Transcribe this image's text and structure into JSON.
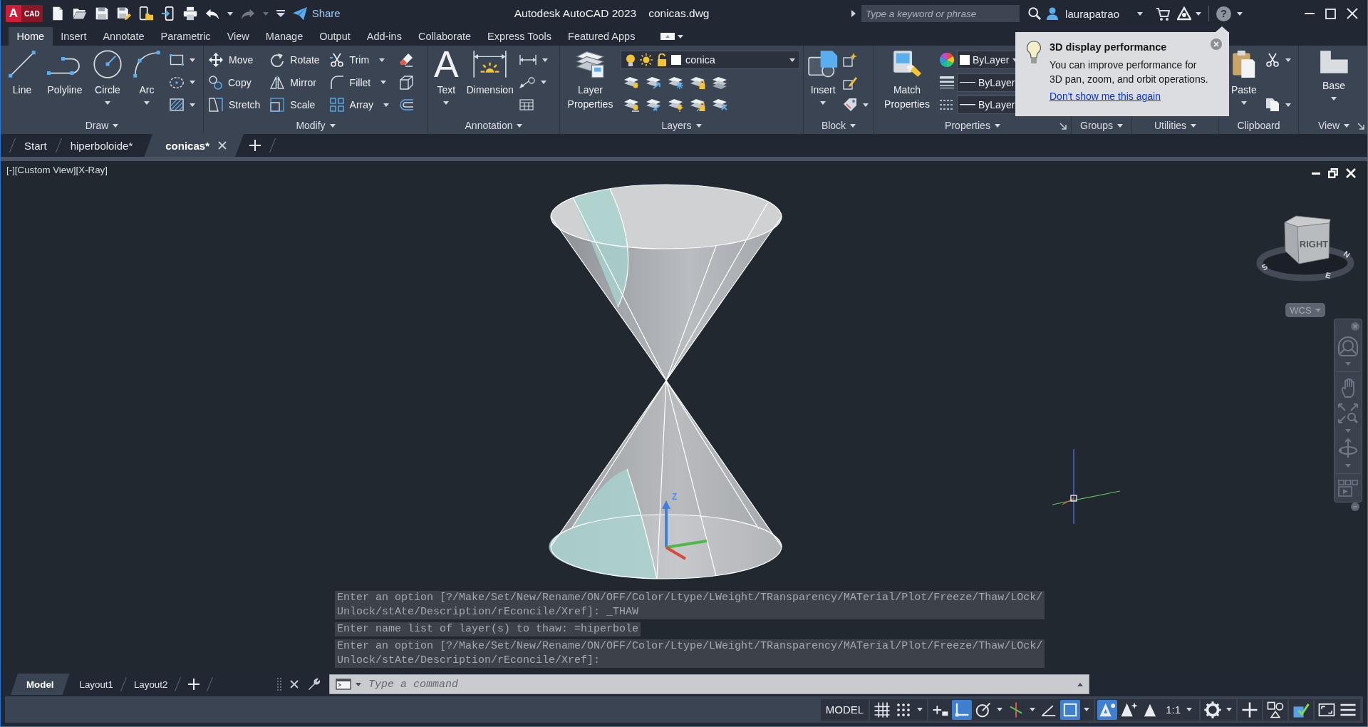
{
  "title_bar": {
    "logo": {
      "letter": "A",
      "text": "CAD"
    },
    "quick_access": [
      {
        "disabled": false
      },
      {
        "disabled": false
      },
      {
        "disabled": false
      },
      {
        "disabled": false
      },
      {
        "disabled": false
      },
      {
        "disabled": false
      },
      {
        "disabled": false
      },
      {
        "disabled": false
      },
      {
        "disabled": true
      }
    ],
    "share": "Share",
    "app_title": "Autodesk AutoCAD 2023",
    "file_name": "conicas.dwg",
    "search": {
      "placeholder": "Type a keyword or phrase"
    },
    "user": "laurapatrao",
    "help": "?"
  },
  "ribbon_tabs": [
    {
      "label": "Home",
      "selected": true
    },
    {
      "label": "Insert",
      "selected": false
    },
    {
      "label": "Annotate",
      "selected": false
    },
    {
      "label": "Parametric",
      "selected": false
    },
    {
      "label": "View",
      "selected": false
    },
    {
      "label": "Manage",
      "selected": false
    },
    {
      "label": "Output",
      "selected": false
    },
    {
      "label": "Add-ins",
      "selected": false
    },
    {
      "label": "Collaborate",
      "selected": false
    },
    {
      "label": "Express Tools",
      "selected": false
    },
    {
      "label": "Featured Apps",
      "selected": false
    }
  ],
  "ribbon_panels": [
    {
      "title": "Draw",
      "menu": true,
      "launcher": false,
      "columns": [
        [
          {
            "kind": "large",
            "label": "Line",
            "dropdown": false
          }
        ],
        [
          {
            "kind": "large",
            "label": "Polyline",
            "dropdown": false
          }
        ],
        [
          {
            "kind": "large",
            "label": "Circle",
            "dropdown": true
          }
        ],
        [
          {
            "kind": "large",
            "label": "Arc",
            "dropdown": true
          }
        ],
        [
          {
            "kind": "icon",
            "dropdown": true
          },
          {
            "kind": "icon",
            "dropdown": true
          },
          {
            "kind": "icon",
            "dropdown": true
          }
        ]
      ]
    },
    {
      "title": "Modify",
      "menu": true,
      "launcher": false,
      "columns": [
        [
          {
            "kind": "small",
            "label": "Move",
            "dropdown": false
          },
          {
            "kind": "small",
            "label": "Copy",
            "dropdown": false
          },
          {
            "kind": "small",
            "label": "Stretch",
            "dropdown": false
          }
        ],
        [
          {
            "kind": "small",
            "label": "Rotate",
            "dropdown": false
          },
          {
            "kind": "small",
            "label": "Mirror",
            "dropdown": false
          },
          {
            "kind": "small",
            "label": "Scale",
            "dropdown": false
          }
        ],
        [
          {
            "kind": "small",
            "label": "Trim",
            "dropdown": true
          },
          {
            "kind": "small",
            "label": "Fillet",
            "dropdown": true
          },
          {
            "kind": "small",
            "label": "Array",
            "dropdown": true
          }
        ],
        [
          {
            "kind": "icon",
            "dropdown": false
          },
          {
            "kind": "icon",
            "dropdown": false
          },
          {
            "kind": "icon",
            "dropdown": false
          }
        ]
      ]
    },
    {
      "title": "Annotation",
      "menu": true,
      "launcher": false,
      "columns": [
        [
          {
            "kind": "large",
            "glyph": "A",
            "label": "Text",
            "dropdown": true
          }
        ],
        [
          {
            "kind": "large",
            "label": "Dimension",
            "dropdown": false
          }
        ],
        [
          {
            "kind": "icon",
            "dropdown": true
          },
          {
            "kind": "icon",
            "dropdown": true
          },
          {
            "kind": "icon",
            "dropdown": false
          }
        ]
      ]
    },
    {
      "title": "Layers",
      "menu": true,
      "launcher": false,
      "columns": [
        [
          {
            "kind": "large",
            "label": "Layer Properties",
            "dropdown": false
          }
        ],
        [
          {
            "kind": "layer_combo",
            "value": "conica"
          },
          {
            "kind": "icon_grid"
          }
        ]
      ]
    },
    {
      "title": "Block",
      "menu": true,
      "launcher": false,
      "columns": [
        [
          {
            "kind": "large",
            "label": "Insert",
            "dropdown": true
          }
        ],
        [
          {
            "kind": "icon",
            "dropdown": false
          },
          {
            "kind": "icon",
            "dropdown": false
          },
          {
            "kind": "icon",
            "dropdown": true
          }
        ]
      ]
    },
    {
      "title": "Properties",
      "menu": true,
      "launcher": true,
      "columns": [
        [
          {
            "kind": "large",
            "label": "Match Properties",
            "dropdown": false
          }
        ],
        [
          {
            "kind": "color_combo",
            "value": "ByLayer"
          },
          {
            "kind": "line_combo",
            "value": "ByLayer"
          },
          {
            "kind": "line_combo",
            "value": "ByLayer"
          }
        ]
      ]
    },
    {
      "title": "Groups",
      "menu": true,
      "launcher": false
    },
    {
      "title": "Utilities",
      "menu": true,
      "launcher": false
    },
    {
      "title": "Clipboard",
      "menu": false,
      "launcher": false,
      "columns": [
        [
          {
            "kind": "large",
            "label": "Paste",
            "dropdown": true
          }
        ],
        [
          {
            "kind": "icon",
            "dropdown": true
          },
          {
            "kind": "icon",
            "dropdown": true
          }
        ]
      ]
    },
    {
      "title": "View",
      "menu": true,
      "launcher": true,
      "columns": [
        [
          {
            "kind": "large",
            "label": "Base",
            "dropdown": true
          }
        ]
      ]
    }
  ],
  "tooltip": {
    "title": "3D display performance",
    "body": "You can improve performance for 3D pan, zoom, and orbit operations.",
    "link": "Don't show me this again"
  },
  "file_tabs": [
    {
      "label": "Start",
      "selected": false
    },
    {
      "label": "hiperboloide*",
      "selected": false
    },
    {
      "label": "conicas*",
      "selected": true
    }
  ],
  "viewport": {
    "view_controls": [
      "[-]",
      "[Custom View]",
      "[X-Ray]"
    ],
    "view_cube": {
      "face": "RIGHT",
      "compass": [
        "S",
        "E",
        "N"
      ]
    },
    "ucs_menu": "WCS",
    "axis_label": "Z"
  },
  "command_history": [
    "Enter an option [?/Make/Set/New/Rename/ON/OFF/Color/Ltype/LWeight/TRansparency/MATerial/Plot/Freeze/Thaw/LOck/Unlock/stAte/Description/rEconcile/Xref]: _THAW",
    "Enter name list of layer(s) to thaw: =hiperbole",
    "Enter an option [?/Make/Set/New/Rename/ON/OFF/Color/Ltype/LWeight/TRansparency/MATerial/Plot/Freeze/Thaw/LOck/Unlock/stAte/Description/rEconcile/Xref]:"
  ],
  "command_line": {
    "placeholder": "Type a command"
  },
  "layout_tabs": [
    {
      "label": "Model",
      "selected": true
    },
    {
      "label": "Layout1",
      "selected": false
    },
    {
      "label": "Layout2",
      "selected": false
    }
  ],
  "status_bar": {
    "space": "MODEL",
    "toggles": [
      {
        "on": false
      },
      {
        "on": false
      },
      {
        "on": false
      },
      {
        "on": true
      },
      {
        "on": false
      },
      {
        "on": false
      },
      {
        "on": false
      },
      {
        "on": true
      },
      {
        "on": true
      },
      {
        "on": false
      },
      {
        "on": false
      }
    ],
    "scale": "1:1"
  }
}
